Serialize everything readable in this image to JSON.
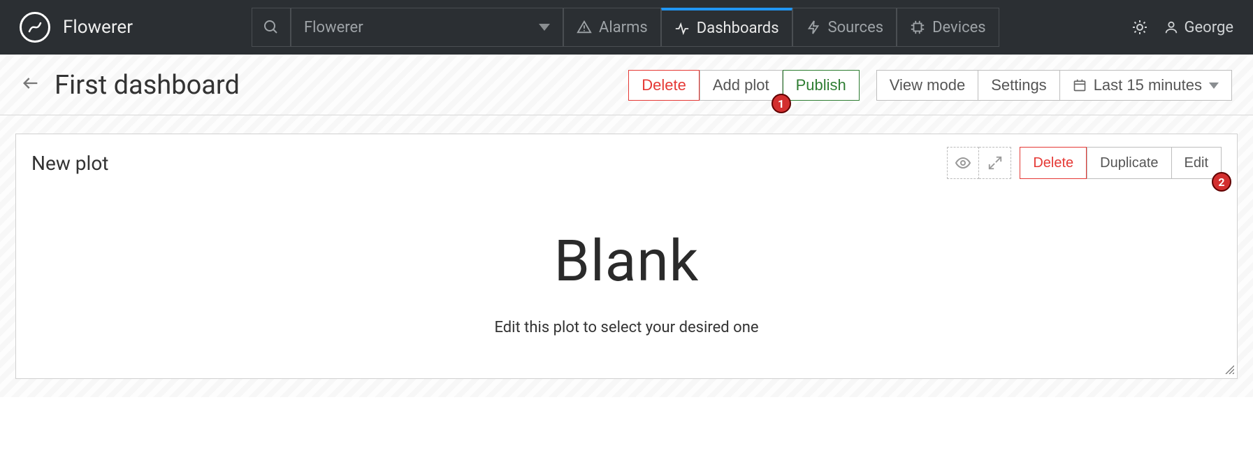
{
  "brand": "Flowerer",
  "search": {
    "selected": "Flowerer"
  },
  "nav": {
    "alarms": "Alarms",
    "dashboards": "Dashboards",
    "sources": "Sources",
    "devices": "Devices"
  },
  "user": {
    "name": "George"
  },
  "page": {
    "title": "First dashboard",
    "buttons": {
      "delete": "Delete",
      "add_plot": "Add plot",
      "publish": "Publish",
      "view_mode": "View mode",
      "settings": "Settings",
      "time_range": "Last 15 minutes"
    }
  },
  "plot_panel": {
    "title": "New plot",
    "buttons": {
      "delete": "Delete",
      "duplicate": "Duplicate",
      "edit": "Edit"
    },
    "blank_title": "Blank",
    "blank_sub": "Edit this plot to select your desired one"
  },
  "markers": {
    "one": "1",
    "two": "2"
  }
}
